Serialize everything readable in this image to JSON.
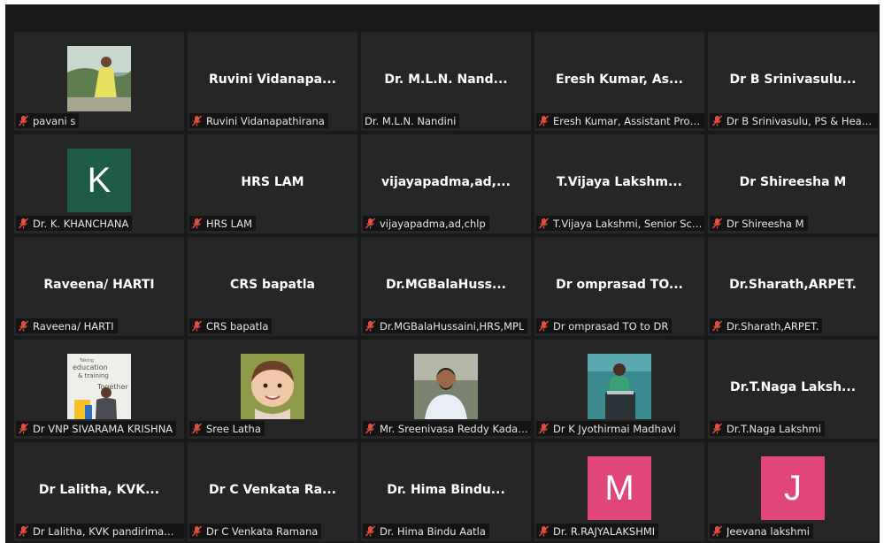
{
  "accent_colors": {
    "avatar_green": "#1e5a48",
    "avatar_pink": "#e0457b",
    "muted_red": "#e05040"
  },
  "participants": [
    {
      "name": "pavani s",
      "label": "pavani s",
      "muted": true,
      "video": "photo-woman-yellow"
    },
    {
      "name": "Ruvini  Vidanapa...",
      "label": "Ruvini Vidanapathirana",
      "muted": true
    },
    {
      "name": "Dr. M.L.N.  Nand...",
      "label": "Dr. M.L.N. Nandini",
      "muted": false
    },
    {
      "name": "Eresh Kumar, As...",
      "label": "Eresh Kumar, Assistant Proff, ...",
      "muted": true
    },
    {
      "name": "Dr B  Srinivasulu...",
      "label": "Dr B Srinivasulu, PS & Head, ...",
      "muted": true
    },
    {
      "name": "Dr. K. KHANCHANA",
      "label": "Dr. K. KHANCHANA",
      "muted": true,
      "avatar_letter": "K"
    },
    {
      "name": "HRS LAM",
      "label": "HRS LAM",
      "muted": true
    },
    {
      "name": "vijayapadma,ad,...",
      "label": "vijayapadma,ad,chlp",
      "muted": true
    },
    {
      "name": "T.Vijaya  Lakshm...",
      "label": "T.Vijaya Lakshmi, Senior Scien...",
      "muted": true
    },
    {
      "name": "Dr Shireesha M",
      "label": "Dr Shireesha M",
      "muted": true
    },
    {
      "name": "Raveena/ HARTI",
      "label": "Raveena/ HARTI",
      "muted": true
    },
    {
      "name": "CRS bapatla",
      "label": "CRS bapatla",
      "muted": true
    },
    {
      "name": "Dr.MGBalaHuss...",
      "label": "Dr.MGBalaHussaini,HRS,MPL",
      "muted": true
    },
    {
      "name": "Dr  omprasad  TO...",
      "label": "Dr omprasad TO to DR",
      "muted": true
    },
    {
      "name": "Dr.Sharath,ARPET.",
      "label": "Dr.Sharath,ARPET.",
      "muted": true
    },
    {
      "name": "Dr VNP SIVARAMA KRISHNA",
      "label": "Dr VNP SIVARAMA KRISHNA",
      "muted": true,
      "video": "photo-man-poster",
      "poster_text": [
        "Taking",
        "education",
        "& training",
        "Together"
      ]
    },
    {
      "name": "Sree Latha",
      "label": "Sree Latha",
      "muted": true,
      "video": "photo-child"
    },
    {
      "name": "Mr. Sreenivasa Reddy Kadapa",
      "label": "Mr. Sreenivasa Reddy Kadapa",
      "muted": true,
      "video": "photo-man-beard"
    },
    {
      "name": "Dr K Jyothirmai Madhavi",
      "label": "Dr K Jyothirmai Madhavi",
      "muted": true,
      "video": "photo-woman-podium"
    },
    {
      "name": "Dr.T.Naga  Laksh...",
      "label": "Dr.T.Naga Lakshmi",
      "muted": true
    },
    {
      "name": "Dr Lalitha, KVK...",
      "label": "Dr Lalitha, KVK pandirimamidi",
      "muted": true
    },
    {
      "name": "Dr C  Venkata  Ra...",
      "label": "Dr C Venkata Ramana",
      "muted": true
    },
    {
      "name": "Dr. Hima  Bindu...",
      "label": "Dr. Hima Bindu Aatla",
      "muted": true
    },
    {
      "name": "Dr. R.RAJYALAKSHMI",
      "label": "Dr. R.RAJYALAKSHMI",
      "muted": true,
      "avatar_letter": "M"
    },
    {
      "name": "Jeevana lakshmi",
      "label": "Jeevana lakshmi",
      "muted": true,
      "avatar_letter": "J"
    }
  ]
}
